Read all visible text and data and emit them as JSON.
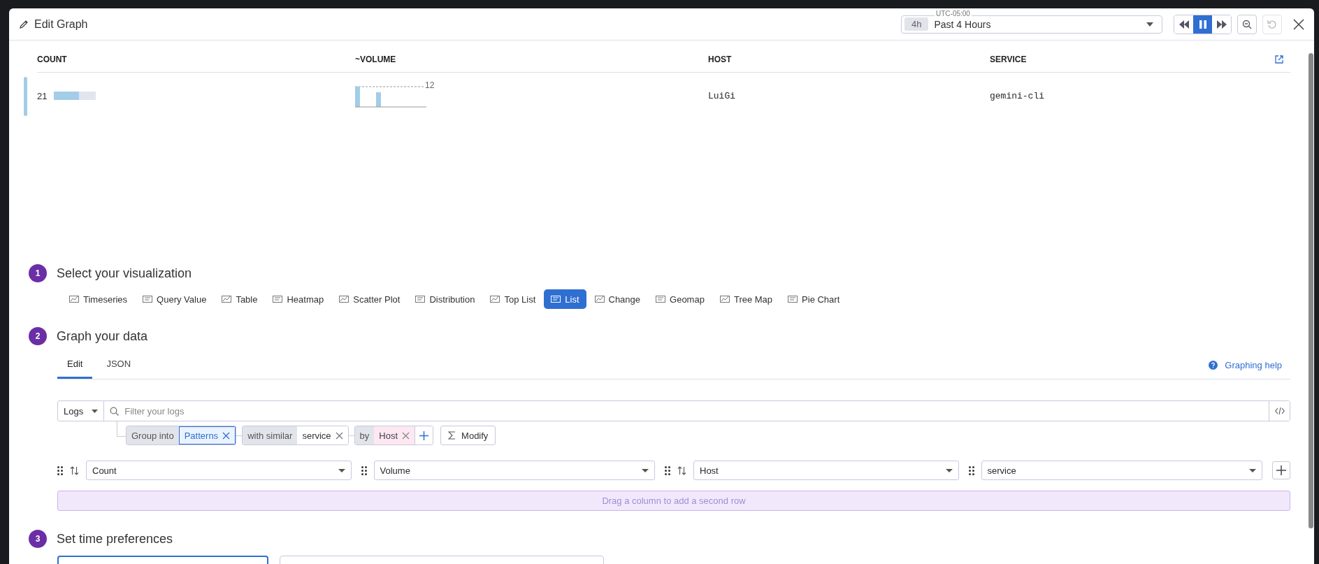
{
  "header": {
    "title": "Edit Graph",
    "timezone": "UTC-05:00",
    "badge": "4h",
    "timeframe": "Past 4 Hours"
  },
  "table": {
    "columns": [
      "COUNT",
      "~VOLUME",
      "HOST",
      "SERVICE"
    ],
    "rows": [
      {
        "count": "21",
        "level": 0.6,
        "volume_max": "12",
        "host": "LuiGi",
        "service": "gemini-cli"
      }
    ]
  },
  "visualization": {
    "number": "1",
    "title": "Select your visualization",
    "options": [
      {
        "label": "Timeseries",
        "selected": false
      },
      {
        "label": "Query Value",
        "selected": false
      },
      {
        "label": "Table",
        "selected": false
      },
      {
        "label": "Heatmap",
        "selected": false
      },
      {
        "label": "Scatter Plot",
        "selected": false
      },
      {
        "label": "Distribution",
        "selected": false
      },
      {
        "label": "Top List",
        "selected": false
      },
      {
        "label": "List",
        "selected": true
      },
      {
        "label": "Change",
        "selected": false
      },
      {
        "label": "Geomap",
        "selected": false
      },
      {
        "label": "Tree Map",
        "selected": false
      },
      {
        "label": "Pie Chart",
        "selected": false
      }
    ]
  },
  "graph": {
    "number": "2",
    "title": "Graph your data",
    "tabs": [
      {
        "label": "Edit",
        "selected": true
      },
      {
        "label": "JSON",
        "selected": false
      }
    ],
    "help": "Graphing help",
    "source": "Logs",
    "filter_placeholder": "Filter your logs",
    "group": {
      "prefix": "Group into",
      "value": "Patterns",
      "similar_label": "with similar",
      "similar_value": "service",
      "by_label": "by",
      "by_value": "Host",
      "modify": "Modify"
    },
    "columns": [
      {
        "label": "Count",
        "sortable": true
      },
      {
        "label": "Volume",
        "sortable": false
      },
      {
        "label": "Host",
        "sortable": true
      },
      {
        "label": "service",
        "sortable": false
      }
    ],
    "drop_hint": "Drag a column to add a second row"
  },
  "time": {
    "number": "3",
    "title": "Set time preferences",
    "boxes": [
      {
        "selected": true
      },
      {
        "selected": false
      }
    ]
  }
}
